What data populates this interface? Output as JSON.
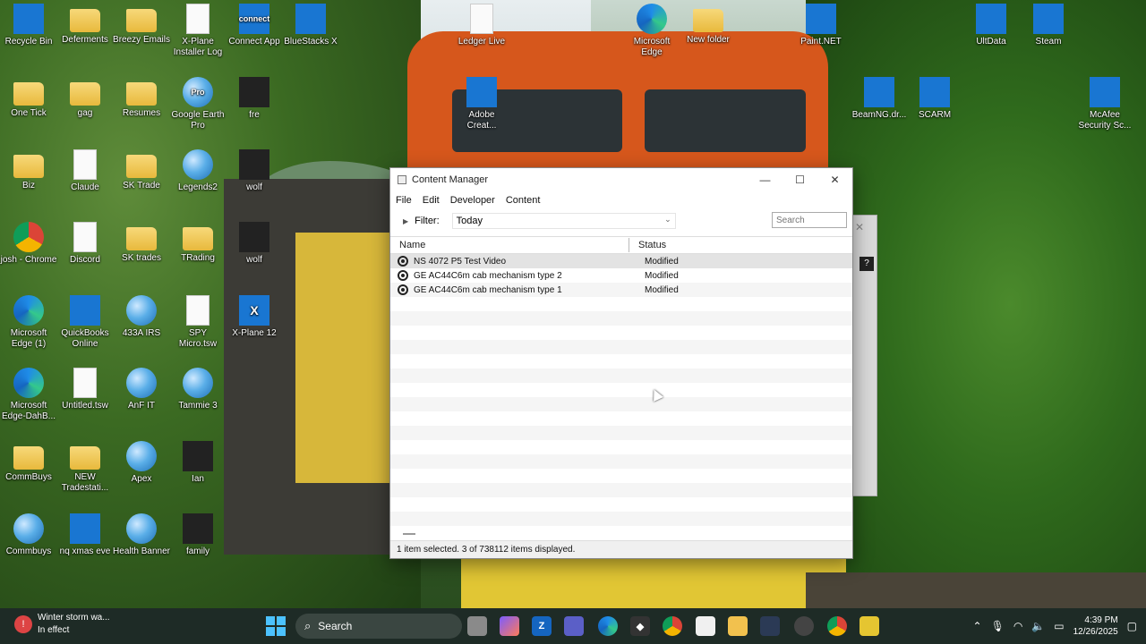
{
  "desktop": {
    "icons": [
      {
        "label": "Recycle Bin",
        "icon": "recycle-bin-icon"
      },
      {
        "label": "Deferments",
        "icon": "folder-icon"
      },
      {
        "label": "Breezy Emails",
        "icon": "folder-icon"
      },
      {
        "label": "X-Plane Installer Log",
        "icon": "document-icon"
      },
      {
        "label": "Connect App",
        "icon": "connect-app-icon",
        "badge": "connect"
      },
      {
        "label": "BlueStacks X",
        "icon": "bluestacks-icon"
      },
      {
        "label": "Ledger Live",
        "icon": "document-icon"
      },
      {
        "label": "Microsoft Edge",
        "icon": "edge-icon"
      },
      {
        "label": "New folder",
        "icon": "folder-icon"
      },
      {
        "label": "Paint.NET",
        "icon": "paintnet-icon"
      },
      {
        "label": "UltData",
        "icon": "ultdata-icon"
      },
      {
        "label": "Steam",
        "icon": "steam-icon"
      },
      {
        "label": "One Tick",
        "icon": "folder-icon"
      },
      {
        "label": "gag",
        "icon": "folder-icon"
      },
      {
        "label": "Resumes",
        "icon": "folder-icon"
      },
      {
        "label": "Google Earth Pro",
        "icon": "google-earth-icon",
        "badge": "Pro"
      },
      {
        "label": "fre",
        "icon": "app-icon"
      },
      {
        "label": "Adobe Creat...",
        "icon": "adobe-cc-icon"
      },
      {
        "label": "BeamNG.dr...",
        "icon": "beamng-icon"
      },
      {
        "label": "SCARM",
        "icon": "scarm-icon"
      },
      {
        "label": "McAfee Security Sc...",
        "icon": "mcafee-icon"
      },
      {
        "label": "Biz",
        "icon": "folder-icon"
      },
      {
        "label": "Claude",
        "icon": "document-icon"
      },
      {
        "label": "SK Trade",
        "icon": "folder-icon"
      },
      {
        "label": "Legends2",
        "icon": "globe-icon"
      },
      {
        "label": "wolf",
        "icon": "wolf-icon"
      },
      {
        "label": "josh - Chrome",
        "icon": "chrome-icon"
      },
      {
        "label": "Discord",
        "icon": "document-icon"
      },
      {
        "label": "SK trades",
        "icon": "folder-icon"
      },
      {
        "label": "TRading",
        "icon": "folder-icon"
      },
      {
        "label": "wolf",
        "icon": "wolf-icon"
      },
      {
        "label": "Microsoft Edge (1)",
        "icon": "edge-icon"
      },
      {
        "label": "QuickBooks Online",
        "icon": "quickbooks-icon"
      },
      {
        "label": "433A IRS",
        "icon": "globe-icon"
      },
      {
        "label": "SPY Micro.tsw",
        "icon": "document-icon"
      },
      {
        "label": "X-Plane 12",
        "icon": "xplane-icon",
        "badge": "X"
      },
      {
        "label": "Microsoft Edge-DahB...",
        "icon": "edge-icon"
      },
      {
        "label": "Untitled.tsw",
        "icon": "document-icon"
      },
      {
        "label": "AnF IT",
        "icon": "globe-icon"
      },
      {
        "label": "Tammie 3",
        "icon": "globe-icon"
      },
      {
        "label": "CommBuys",
        "icon": "folder-icon"
      },
      {
        "label": "NEW Tradestati...",
        "icon": "folder-icon"
      },
      {
        "label": "Apex",
        "icon": "globe-icon"
      },
      {
        "label": "Ian",
        "icon": "photo-icon"
      },
      {
        "label": "Commbuys",
        "icon": "globe-icon"
      },
      {
        "label": "nq xmas eve",
        "icon": "image-icon"
      },
      {
        "label": "Health Banner",
        "icon": "globe-icon"
      },
      {
        "label": "family",
        "icon": "photo-icon"
      }
    ]
  },
  "content_manager": {
    "title": "Content Manager",
    "menu": [
      "File",
      "Edit",
      "Developer",
      "Content"
    ],
    "filter_label": "Filter:",
    "filter_value": "Today",
    "search_placeholder": "Search",
    "columns": {
      "name": "Name",
      "status": "Status"
    },
    "rows": [
      {
        "name": "NS 4072 P5 Test Video",
        "status": "Modified",
        "selected": true
      },
      {
        "name": "GE AC44C6m cab mechanism type 2",
        "status": "Modified",
        "selected": false
      },
      {
        "name": "GE AC44C6m cab mechanism type 1",
        "status": "Modified",
        "selected": false
      }
    ],
    "status_text": "1 item selected. 3 of 738112 items displayed."
  },
  "taskbar": {
    "weather_title": "Winter storm wa...",
    "weather_subtitle": "In effect",
    "search_label": "Search",
    "time": "4:39 PM",
    "date": "12/26/2025"
  }
}
